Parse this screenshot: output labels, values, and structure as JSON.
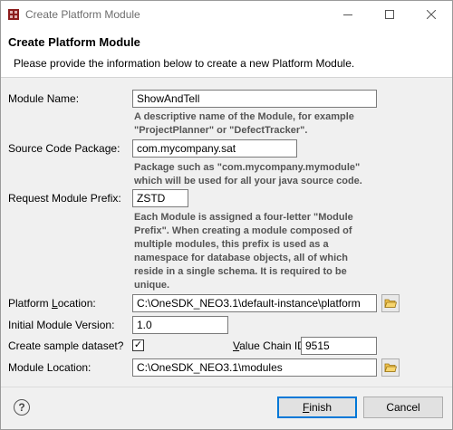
{
  "window": {
    "title": "Create Platform Module",
    "icon": "eclipse-app-icon"
  },
  "header": {
    "title": "Create Platform Module",
    "description": "Please provide the information below to create a new Platform Module."
  },
  "form": {
    "module_name": {
      "label": "Module Name:",
      "value": "ShowAndTell",
      "hint": "A descriptive name of the Module, for example \"ProjectPlanner\" or \"DefectTracker\"."
    },
    "source_code_package": {
      "label": "Source Code Package:",
      "value": "com.mycompany.sat",
      "hint": "Package such as \"com.mycompany.mymodule\" which will be used for all your java source code."
    },
    "request_module_prefix": {
      "label": "Request Module Prefix:",
      "value": "ZSTD",
      "hint": "Each Module is assigned a four-letter \"Module Prefix\". When creating a module composed of multiple modules, this prefix is used as a namespace for database objects, all of which reside in a single schema. It is required to be unique."
    },
    "platform_location": {
      "label_pre": "Platform ",
      "label_accel": "L",
      "label_post": "ocation:",
      "value": "C:\\OneSDK_NEO3.1\\default-instance\\platform"
    },
    "initial_module_version": {
      "label": "Initial Module Version:",
      "value": "1.0"
    },
    "create_sample_dataset": {
      "label": "Create sample dataset?",
      "checked": true,
      "check_glyph": "✓"
    },
    "value_chain_id": {
      "label_accel": "V",
      "label_post": "alue Chain ID:",
      "value": "9515"
    },
    "module_location": {
      "label": "Module Location:",
      "value": "C:\\OneSDK_NEO3.1\\modules"
    }
  },
  "footer": {
    "help_glyph": "?",
    "finish_accel": "F",
    "finish_post": "inish",
    "cancel_label": "Cancel"
  }
}
